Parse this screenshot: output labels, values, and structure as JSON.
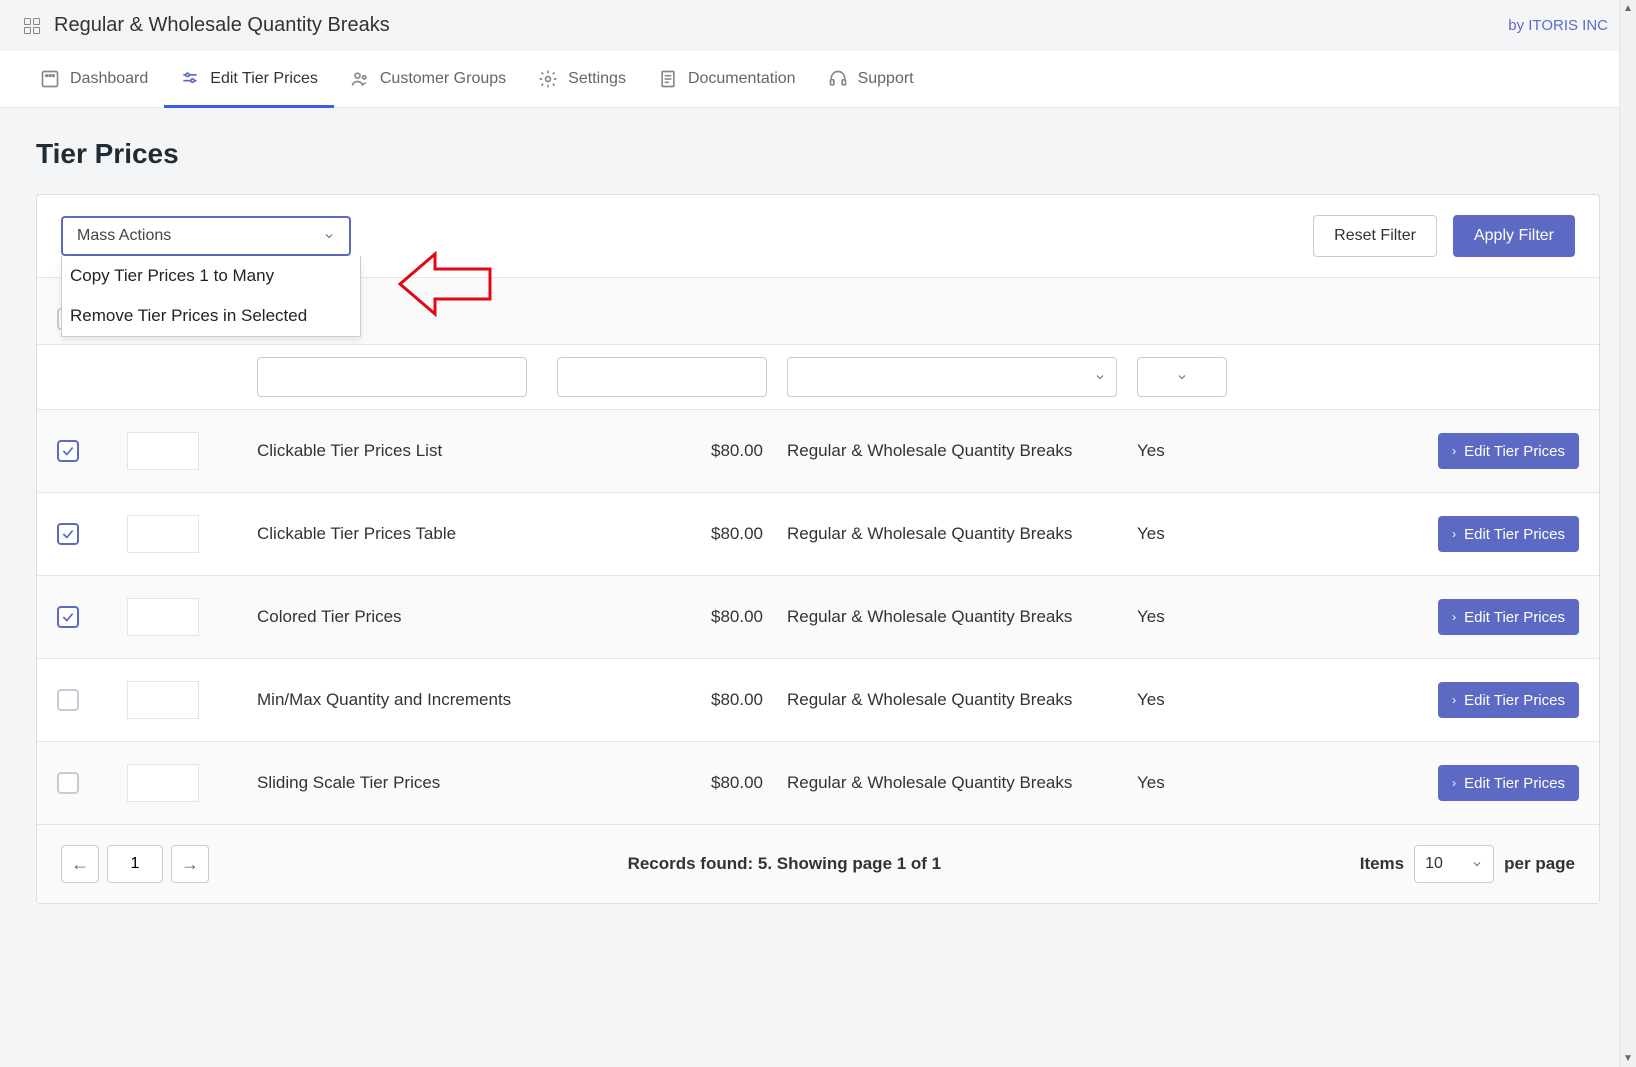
{
  "header": {
    "app_title": "Regular & Wholesale Quantity Breaks",
    "vendor_prefix": "by ",
    "vendor": "ITORIS INC"
  },
  "nav": {
    "dashboard": "Dashboard",
    "edit_tier_prices": "Edit Tier Prices",
    "customer_groups": "Customer Groups",
    "settings": "Settings",
    "documentation": "Documentation",
    "support": "Support"
  },
  "page": {
    "title": "Tier Prices"
  },
  "mass_actions": {
    "label": "Mass Actions",
    "options": {
      "copy": "Copy Tier Prices 1 to Many",
      "remove": "Remove Tier Prices in Selected"
    }
  },
  "buttons": {
    "reset_filter": "Reset Filter",
    "apply_filter": "Apply Filter",
    "edit": "Edit Tier Prices"
  },
  "rows": [
    {
      "checked": true,
      "name": "Clickable Tier Prices List",
      "price": "$80.00",
      "desc": "Regular & Wholesale Quantity Breaks",
      "active": "Yes"
    },
    {
      "checked": true,
      "name": "Clickable Tier Prices Table",
      "price": "$80.00",
      "desc": "Regular & Wholesale Quantity Breaks",
      "active": "Yes"
    },
    {
      "checked": true,
      "name": "Colored Tier Prices",
      "price": "$80.00",
      "desc": "Regular & Wholesale Quantity Breaks",
      "active": "Yes"
    },
    {
      "checked": false,
      "name": "Min/Max Quantity and Increments",
      "price": "$80.00",
      "desc": "Regular & Wholesale Quantity Breaks",
      "active": "Yes"
    },
    {
      "checked": false,
      "name": "Sliding Scale Tier Prices",
      "price": "$80.00",
      "desc": "Regular & Wholesale Quantity Breaks",
      "active": "Yes"
    }
  ],
  "footer": {
    "page": "1",
    "records_text": "Records found: 5. Showing page 1 of 1",
    "items_label": "Items",
    "items_value": "10",
    "per_page": "per page"
  }
}
